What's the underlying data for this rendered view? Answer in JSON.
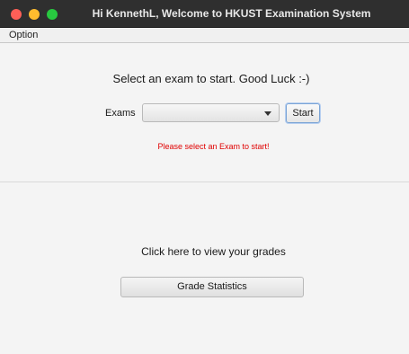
{
  "window": {
    "title": "Hi KennethL, Welcome to HKUST Examination System"
  },
  "menubar": {
    "items": [
      {
        "label": "Option"
      }
    ]
  },
  "exam_panel": {
    "prompt": "Select an exam to start. Good Luck :-)",
    "exams_label": "Exams",
    "exam_select_value": "",
    "start_label": "Start",
    "error_message": "Please select an Exam to start!"
  },
  "grades_panel": {
    "prompt": "Click here to view your grades",
    "button_label": "Grade Statistics"
  },
  "colors": {
    "error": "#e00000",
    "close": "#ff5f57",
    "minimize": "#febc2e",
    "zoom": "#28c840"
  },
  "icons": [
    "close-icon",
    "minimize-icon",
    "zoom-icon",
    "chevron-down-icon"
  ]
}
